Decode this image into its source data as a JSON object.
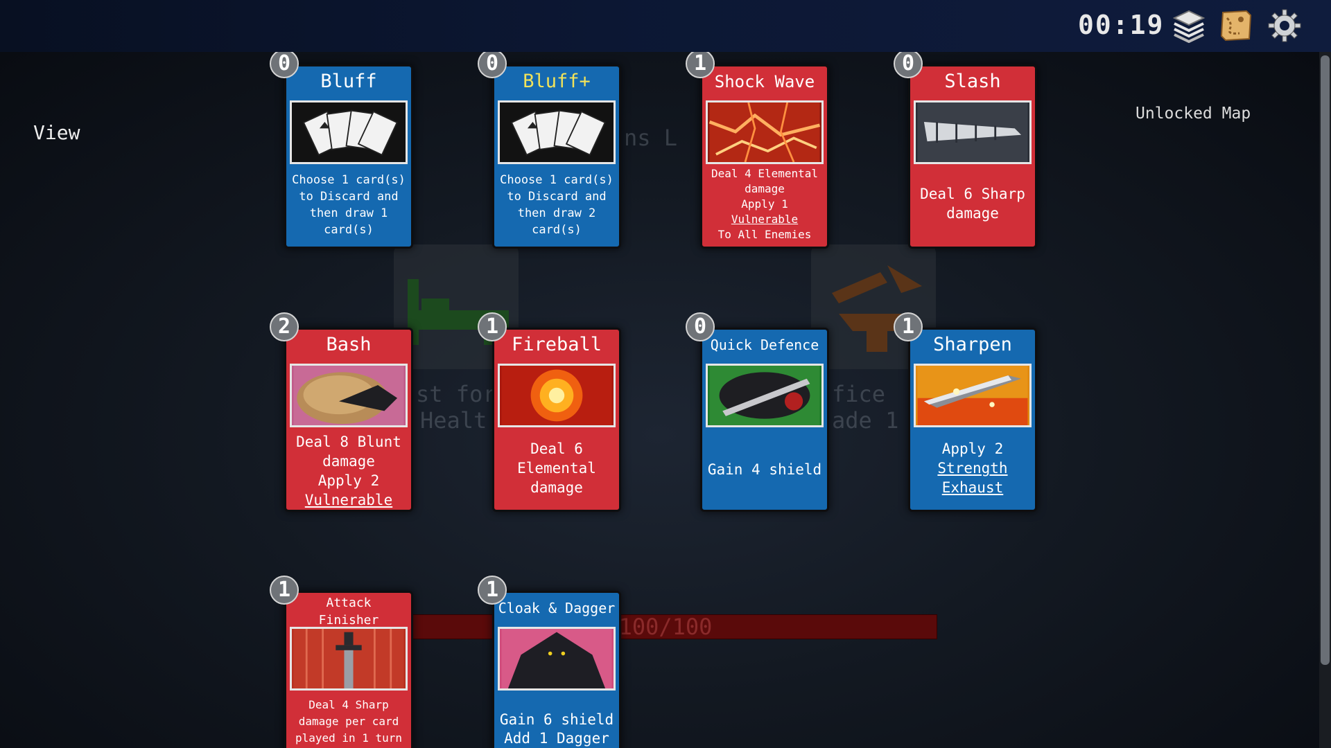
{
  "hud": {
    "timer": "00:19",
    "deck_icon": "card-deck-icon",
    "map_icon": "map-scroll-icon",
    "settings_icon": "gear-icon"
  },
  "view_label": "View",
  "unlocked_map_label": "Unlocked Map",
  "background_map": {
    "text_1": "ns L",
    "text_2": "st for",
    "text_3": "Healt",
    "text_4": "fice",
    "text_5": "ade 1",
    "health": "100/100"
  },
  "cards": [
    {
      "cost": "0",
      "title": "Bluff",
      "desc": "Choose 1 card(s)\nto Discard and\nthen draw 1\ncard(s)",
      "color": "blue",
      "art": "fan-of-cards"
    },
    {
      "cost": "0",
      "title": "Bluff+",
      "desc": "Choose 1 card(s)\nto Discard and\nthen draw 2\ncard(s)",
      "color": "blue",
      "art": "fan-of-cards"
    },
    {
      "cost": "1",
      "title": "Shock Wave",
      "desc": "Deal 4 Elemental\ndamage\nApply 1\nVulnerable\nTo All Enemies",
      "color": "red",
      "art": "lightning"
    },
    {
      "cost": "0",
      "title": "Slash",
      "desc": "Deal 6 Sharp\ndamage",
      "color": "red",
      "art": "blade-slash"
    },
    {
      "cost": "2",
      "title": "Bash",
      "desc": "Deal 8 Blunt\ndamage\nApply 2\nVulnerable",
      "color": "red",
      "art": "boulder"
    },
    {
      "cost": "1",
      "title": "Fireball",
      "desc": "Deal 6\nElemental\ndamage",
      "color": "red",
      "art": "fire"
    },
    {
      "cost": "0",
      "title": "Quick Defence",
      "desc": "Gain 4 shield",
      "color": "blue",
      "art": "shield-sword"
    },
    {
      "cost": "1",
      "title": "Sharpen",
      "desc": "Apply 2\nStrength\nExhaust",
      "color": "blue",
      "art": "sharpen-blade"
    },
    {
      "cost": "1",
      "title": "Attack\nFinisher",
      "desc": "Deal 4 Sharp\ndamage per card\nplayed in 1 turn",
      "color": "red",
      "art": "sword"
    },
    {
      "cost": "1",
      "title": "Cloak & Dagger",
      "desc": "Gain 6 shield\nAdd 1 Dagger",
      "color": "blue",
      "art": "cloaked-figure"
    }
  ],
  "colors": {
    "card_blue": "#1569b0",
    "card_red": "#d12f38",
    "upgraded_title": "#f2e35a",
    "health_bar": "#5a0a0a"
  }
}
